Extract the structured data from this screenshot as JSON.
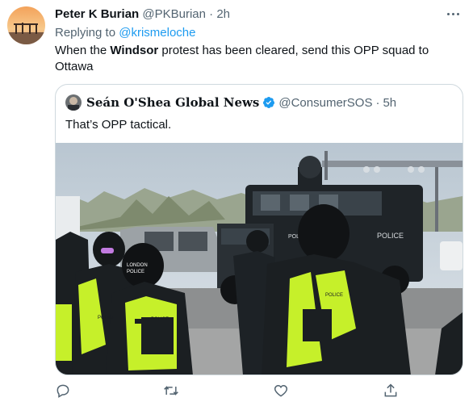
{
  "tweet": {
    "author_name": "Peter K Burian",
    "author_handle": "@PKBurian",
    "separator": "·",
    "time": "2h",
    "replying_prefix": "Replying to ",
    "replying_handle": "@krismeloche",
    "text_before": "When the ",
    "text_bold": "Windsor",
    "text_after": " protest has been cleared, send this OPP squad to Ottawa"
  },
  "quoted": {
    "author_name": "Seán O'Shea Global News",
    "author_handle": "@ConsumerSOS",
    "separator": "·",
    "time": "5h",
    "text": "That’s OPP tactical.",
    "image_texts": {
      "vehicle_side": "POLICE",
      "vehicle_front": "POLI",
      "patch_1": "LONDON",
      "patch_2": "POLICE",
      "vest_left": "POLICE",
      "vest_center": "POLICE",
      "vest_right": "POLICE"
    }
  },
  "actions": [
    {
      "name": "reply-icon"
    },
    {
      "name": "retweet-icon"
    },
    {
      "name": "like-icon"
    },
    {
      "name": "share-icon"
    }
  ],
  "colors": {
    "link": "#1d9bf0",
    "muted": "#536471",
    "border": "#cfd9de",
    "vest": "#c6f02a"
  }
}
